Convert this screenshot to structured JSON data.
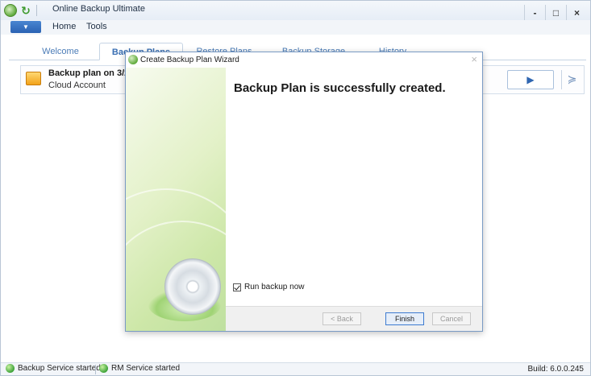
{
  "window": {
    "title": "Online Backup Ultimate",
    "controls": {
      "minimize": "-",
      "maximize": "□",
      "close": "×"
    }
  },
  "menu": {
    "items": [
      "Home",
      "Tools"
    ]
  },
  "tabs": [
    {
      "label": "Welcome",
      "active": false
    },
    {
      "label": "Backup Plans",
      "active": true
    },
    {
      "label": "Restore Plans",
      "active": false
    },
    {
      "label": "Backup Storage",
      "active": false
    },
    {
      "label": "History",
      "active": false
    }
  ],
  "plan": {
    "name": "Backup plan on 3/29/2",
    "account": "Cloud Account",
    "run_icon": "play-icon",
    "expand_icon": "chevron-double-down-icon"
  },
  "dialog": {
    "title": "Create Backup Plan Wizard",
    "close": "×",
    "heading": "Backup Plan is successfully created.",
    "checkbox_label": "Run backup now",
    "checkbox_checked": true,
    "buttons": {
      "back": "< Back",
      "finish": "Finish",
      "cancel": "Cancel"
    }
  },
  "status": {
    "backup_service": "Backup Service started",
    "rm_service": "RM Service started",
    "build": "Build: 6.0.0.245"
  },
  "colors": {
    "accent": "#3a6fb3",
    "tab_text": "#4b7cb7",
    "status_green": "#3ea33a"
  }
}
